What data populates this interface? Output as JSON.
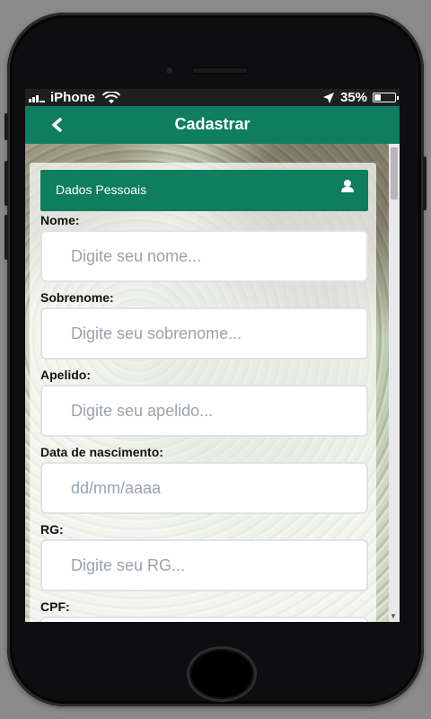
{
  "status_bar": {
    "carrier": "iPhone",
    "battery_percent": "35%",
    "battery_level": 0.35
  },
  "app_bar": {
    "back_icon": "chevron-left-icon",
    "title": "Cadastrar"
  },
  "section": {
    "title": "Dados Pessoais",
    "icon": "user-icon"
  },
  "fields": [
    {
      "label": "Nome:",
      "placeholder": "Digite seu nome..."
    },
    {
      "label": "Sobrenome:",
      "placeholder": "Digite seu sobrenome..."
    },
    {
      "label": "Apelido:",
      "placeholder": "Digite seu apelido..."
    },
    {
      "label": "Data de nascimento:",
      "placeholder": "dd/mm/aaaa"
    },
    {
      "label": "RG:",
      "placeholder": "Digite seu RG..."
    },
    {
      "label": "CPF:",
      "placeholder": ""
    }
  ],
  "colors": {
    "primary": "#0f7d5f"
  }
}
